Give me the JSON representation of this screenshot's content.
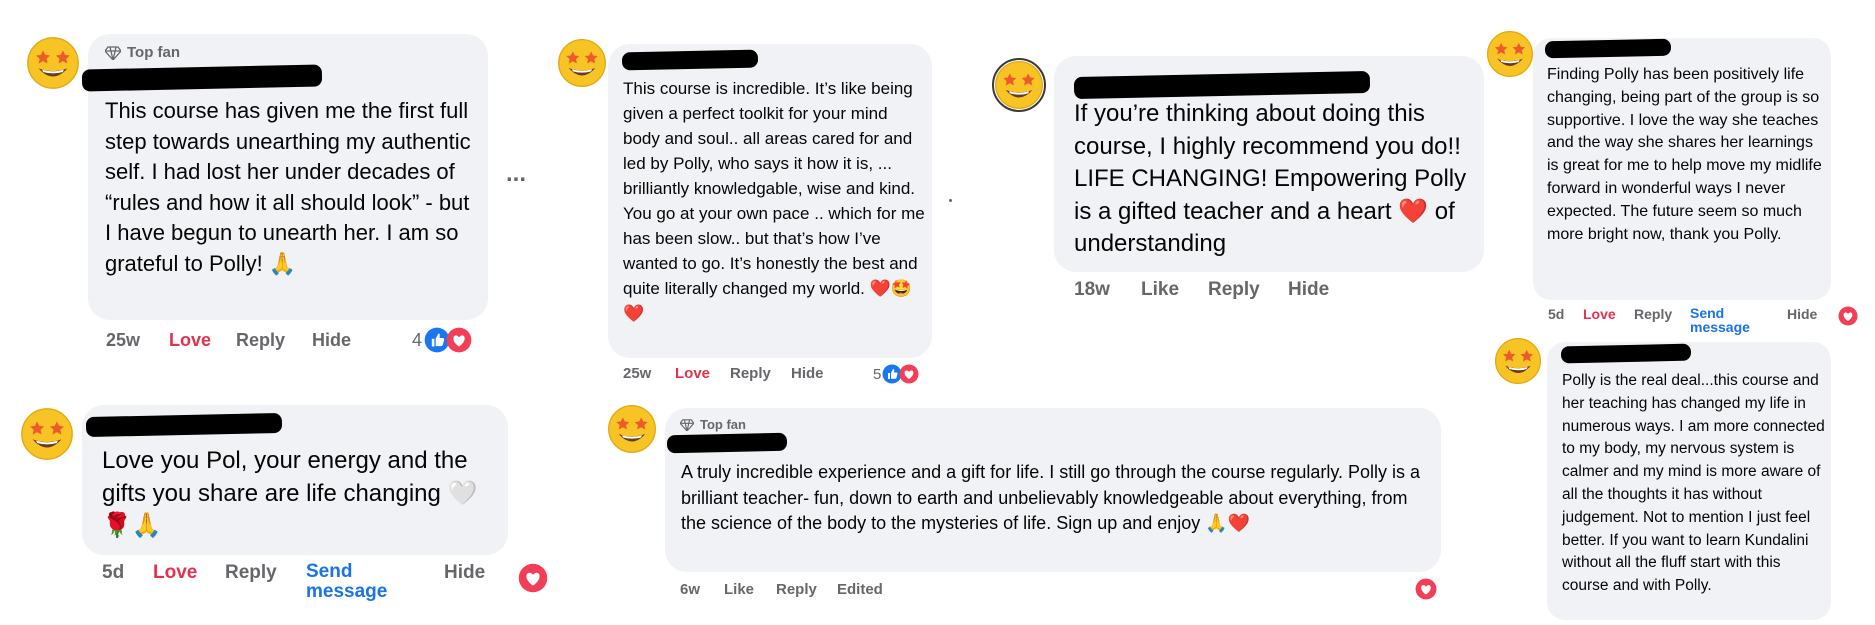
{
  "labels": {
    "top_fan": "Top fan",
    "like": "Like",
    "love": "Love",
    "reply": "Reply",
    "hide": "Hide",
    "send_message": "Send message",
    "edited": "Edited",
    "more": "..."
  },
  "comments": [
    {
      "badge": "Top fan",
      "text": "This course has given me the first full step towards unearthing my authentic self. I had lost her under decades of “rules and how it all should look” - but I have begun to unearth her. I am so grateful to Polly! 🙏",
      "time": "25w",
      "reaction": "Love",
      "reaction_count": "4"
    },
    {
      "text": "Love you Pol, your energy and the gifts you share are life changing 🤍🌹🙏",
      "time": "5d",
      "reaction": "Love"
    },
    {
      "text": "This course is incredible. It’s like being given a perfect toolkit for your mind body and soul.. all areas cared for and led by Polly, who says it how it is, ... brilliantly knowledgable, wise and kind. You go at your own pace .. which for me has been slow.. but that’s how I’ve wanted to go. It’s honestly the best and quite literally changed my world. ❤️🤩❤️",
      "time": "25w",
      "reaction": "Love",
      "reaction_count": "5"
    },
    {
      "badge": "Top fan",
      "text": "A truly incredible experience and a gift for life. I still go through the course regularly. Polly is a brilliant teacher- fun, down to earth and unbelievably knowledgeable about everything, from the science of the body to the mysteries of life. Sign up and enjoy 🙏❤️",
      "time": "6w"
    },
    {
      "text": "If you’re thinking about doing this course, I highly recommend you do!! LIFE CHANGING! Empowering Polly is a gifted teacher and a heart ❤️ of understanding",
      "time": "18w"
    },
    {
      "text": "Finding Polly has been positively life changing, being part of the group is so supportive. I love the way she teaches and the way she shares her learnings is great for me to help move my midlife forward in wonderful ways I never expected. The future seem so much more bright now, thank you Polly.",
      "time": "5d",
      "reaction": "Love"
    },
    {
      "text": "Polly is the real deal...this course and her teaching has changed my life in numerous ways. I am more connected to my body, my nervous system is calmer and my mind is more aware of all the thoughts it has without judgement. Not to mention I just feel better. If you want to learn Kundalini without all the fluff start with this course and with Polly."
    }
  ],
  "colors": {
    "bubble": "#f0f2f5",
    "meta": "#65676b",
    "love": "#e4314e",
    "link": "#1a73e8",
    "like_blue": "#1877f2",
    "heart_red": "#f33e58"
  },
  "icons": [
    "star-struck-emoji-avatar",
    "diamond-icon",
    "like-icon",
    "heart-icon"
  ]
}
